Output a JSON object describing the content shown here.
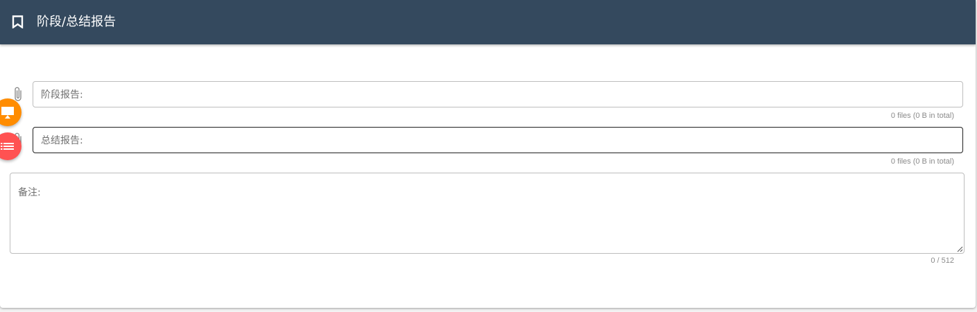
{
  "header": {
    "title": "阶段/总结报告",
    "icon": "bookmark-icon"
  },
  "form": {
    "stage_report": {
      "label": "阶段报告:",
      "hint": "0 files (0 B in total)",
      "icon": "paperclip-icon"
    },
    "summary_report": {
      "label": "总结报告:",
      "hint": "0 files (0 B in total)",
      "icon": "paperclip-icon"
    },
    "remarks": {
      "label": "备注:",
      "counter": "0 / 512"
    }
  },
  "fabs": [
    {
      "icon": "present-to-all-icon",
      "color": "#ff8c00"
    },
    {
      "icon": "list-icon",
      "color": "#ff5252"
    }
  ],
  "colors": {
    "header_bg": "#34495e",
    "border": "#bdbdbd",
    "focused_border": "#1f1f1f"
  }
}
